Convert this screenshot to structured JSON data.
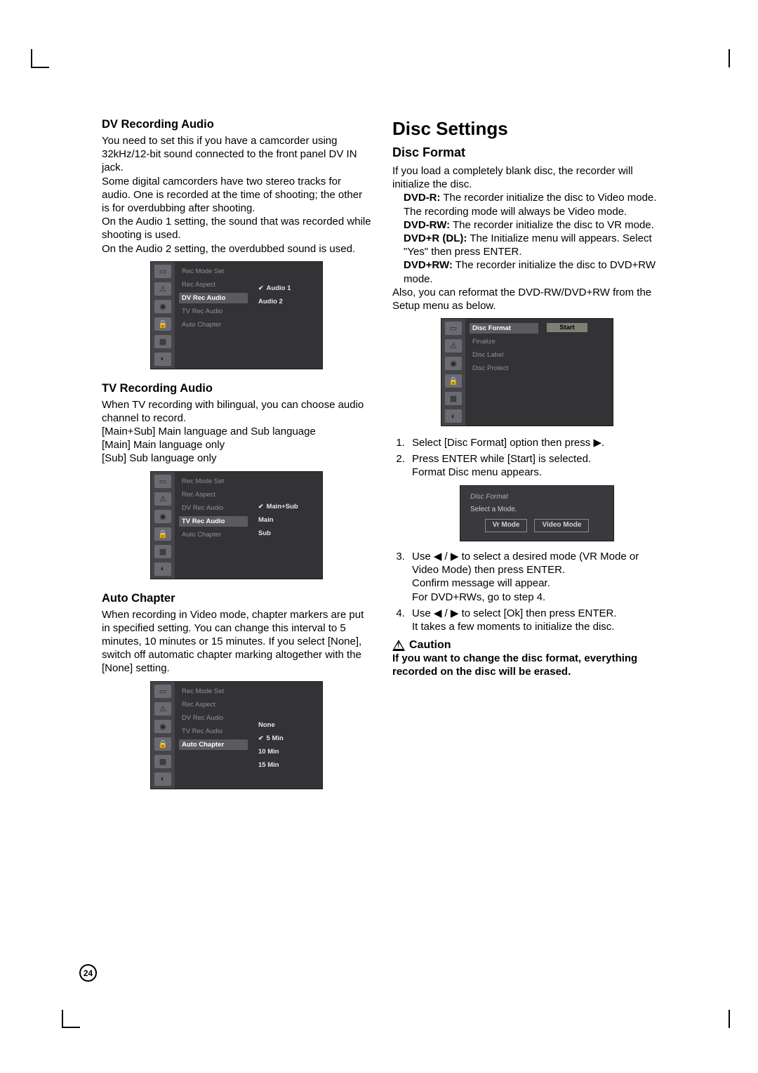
{
  "page_number": "24",
  "left": {
    "dv": {
      "heading": "DV Recording Audio",
      "p1": "You need to set this if you have a camcorder using 32kHz/12-bit sound connected to the front panel DV IN jack.",
      "p2": "Some digital camcorders have two stereo tracks for audio. One is recorded at the time of shooting; the other is for overdubbing after shooting.",
      "p3": "On the Audio 1 setting, the sound that was recorded while shooting is used.",
      "p4": "On the Audio 2 setting, the overdubbed sound is used.",
      "osd": {
        "menu": [
          "Rec Mode Set",
          "Rec Aspect",
          "DV Rec Audio",
          "TV Rec Audio",
          "Auto Chapter"
        ],
        "selected_index": 2,
        "options": [
          "Audio 1",
          "Audio 2"
        ],
        "checked_index": 0
      }
    },
    "tv": {
      "heading": "TV Recording Audio",
      "p1": "When TV recording with bilingual, you can choose audio channel to record.",
      "l1": "[Main+Sub] Main language and Sub language",
      "l2": "[Main] Main language only",
      "l3": "[Sub] Sub language only",
      "osd": {
        "menu": [
          "Rec Mode Set",
          "Rec Aspect",
          "DV Rec Audio",
          "TV Rec Audio",
          "Auto Chapter"
        ],
        "selected_index": 3,
        "options": [
          "Main+Sub",
          "Main",
          "Sub"
        ],
        "checked_index": 0
      }
    },
    "auto": {
      "heading": "Auto Chapter",
      "p1": "When recording in Video mode, chapter markers are put in specified setting. You can change this interval to 5 minutes, 10 minutes or 15 minutes. If you select [None], switch off automatic chapter marking altogether with the [None] setting.",
      "osd": {
        "menu": [
          "Rec Mode Set",
          "Rec Aspect",
          "DV Rec Audio",
          "TV Rec Audio",
          "Auto Chapter"
        ],
        "selected_index": 4,
        "options": [
          "None",
          "5 Min",
          "10 Min",
          "15 Min"
        ],
        "checked_index": 1
      }
    }
  },
  "right": {
    "title": "Disc Settings",
    "format": {
      "heading": "Disc Format",
      "p1": "If you load a completely blank disc, the recorder will initialize the disc.",
      "dvd_r_label": "DVD-R:",
      "dvd_r": " The recorder initialize the disc to Video mode. The recording mode will always be Video mode.",
      "dvd_rw_label": "DVD-RW:",
      "dvd_rw": " The recorder initialize the disc to VR mode.",
      "dvd_rdl_label": "DVD+R (DL):",
      "dvd_rdl": " The Initialize menu will appears. Select \"Yes\" then press ENTER.",
      "dvd_prw_label": "DVD+RW:",
      "dvd_prw": " The recorder initialize the disc to DVD+RW mode.",
      "p2": "Also, you can reformat the DVD-RW/DVD+RW from the Setup menu as below.",
      "osd": {
        "menu": [
          "Disc Format",
          "Finalize",
          "Disc Label",
          "Disc Protect"
        ],
        "selected_index": 0,
        "start_label": "Start"
      },
      "step1": "Select [Disc Format] option then press ▶.",
      "step2a": "Press ENTER while [Start] is selected.",
      "step2b": "Format Disc menu appears.",
      "osd2": {
        "title": "Disc Format",
        "sub": "Select a Mode.",
        "btn1": "Vr Mode",
        "btn2": "Video Mode"
      },
      "step3a": "Use ◀ / ▶ to select a desired mode (VR Mode or Video Mode) then press ENTER.",
      "step3b": "Confirm message will appear.",
      "step3c": "For DVD+RWs, go to step 4.",
      "step4a": "Use ◀ / ▶ to select [Ok] then press ENTER.",
      "step4b": "It takes a few moments to initialize the disc.",
      "caution_label": "Caution",
      "caution": "If you want to change the disc format, everything recorded on the disc will be erased."
    }
  },
  "icons": [
    "▭",
    "⚠",
    "◉",
    "🔒",
    "▦",
    "◐"
  ]
}
